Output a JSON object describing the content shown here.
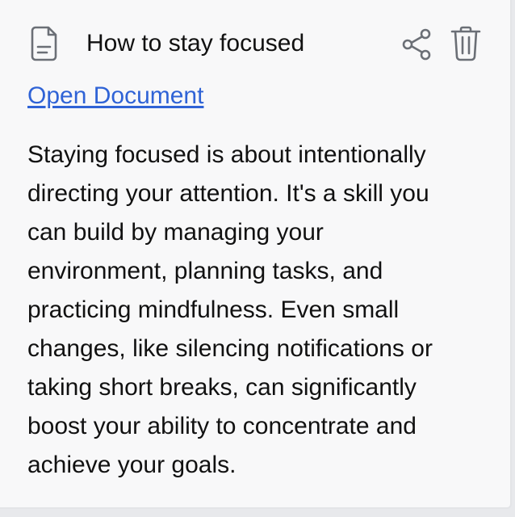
{
  "card": {
    "title": "How to stay focused",
    "open_link_label": "Open Document",
    "body_lines": [
      "Staying focused is about intentionally",
      "directing your attention. It's a skill you",
      "can build by managing your",
      "environment, planning tasks, and",
      "practicing mindfulness. Even small",
      "changes, like silencing notifications or",
      "taking short breaks, can significantly",
      "boost your ability to concentrate and",
      "achieve your goals."
    ]
  },
  "icons": {
    "document": "document-icon",
    "share": "share-icon",
    "trash": "trash-icon"
  },
  "colors": {
    "link": "#2f63d6",
    "icon": "#6b6f76",
    "card_background": "#f8f8f9"
  }
}
